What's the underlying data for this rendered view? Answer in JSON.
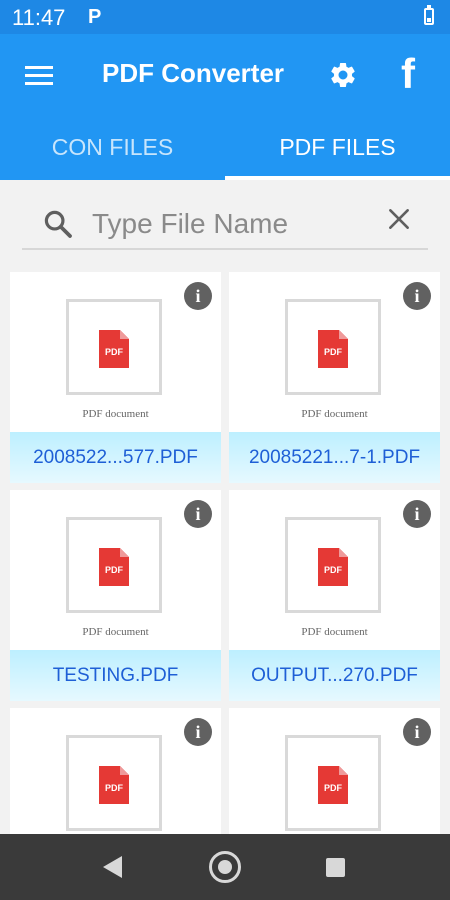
{
  "status_bar": {
    "time": "11:47",
    "notification": "P"
  },
  "app_bar": {
    "title": "PDF Converter",
    "facebook_label": "f"
  },
  "tabs": [
    {
      "label": "CON FILES",
      "selected": false
    },
    {
      "label": "PDF FILES",
      "selected": true
    }
  ],
  "search": {
    "placeholder": "Type File Name",
    "value": ""
  },
  "file_grid": {
    "thumbnail_caption": "PDF document",
    "pdf_badge": "PDF",
    "info_label": "i",
    "files": [
      {
        "name": "2008522...577.PDF"
      },
      {
        "name": "20085221...7-1.PDF"
      },
      {
        "name": "TESTING.PDF"
      },
      {
        "name": "OUTPUT...270.PDF"
      },
      {
        "name": ""
      },
      {
        "name": ""
      }
    ]
  },
  "colors": {
    "status_bar": "#1e88e5",
    "app_bar": "#2196f3",
    "pdf_red": "#e53935",
    "file_name_text": "#1e5fd6",
    "name_band": "#c7f1ff"
  },
  "icons": {
    "menu": "hamburger-icon",
    "settings": "gear-icon",
    "social": "facebook-icon",
    "search": "search-icon",
    "clear": "close-icon",
    "info": "info-icon",
    "file": "pdf-file-icon",
    "nav": [
      "back-icon",
      "home-icon",
      "recents-icon"
    ]
  }
}
